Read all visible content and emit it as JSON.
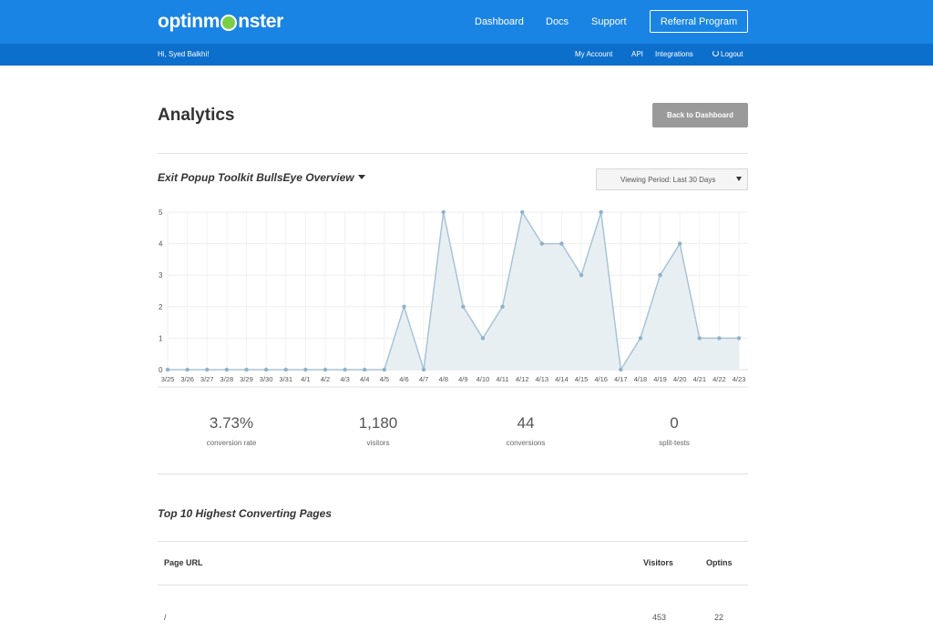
{
  "header": {
    "logo_pre": "optinm",
    "logo_post": "nster",
    "nav": [
      "Dashboard",
      "Docs",
      "Support"
    ],
    "referral_label": "Referral Program"
  },
  "subbar": {
    "greeting": "Hi, Syed Balkhi!",
    "my_account": "My Account",
    "api": "API",
    "integrations": "Integrations",
    "logout": "Logout"
  },
  "page": {
    "title": "Analytics",
    "back_label": "Back to Dashboard"
  },
  "overview": {
    "title": "Exit Popup Toolkit BullsEye Overview",
    "period_label": "Viewing Period: Last 30 Days"
  },
  "chart_data": {
    "type": "area",
    "categories": [
      "3/25",
      "3/26",
      "3/27",
      "3/28",
      "3/29",
      "3/30",
      "3/31",
      "4/1",
      "4/2",
      "4/3",
      "4/4",
      "4/5",
      "4/6",
      "4/7",
      "4/8",
      "4/9",
      "4/10",
      "4/11",
      "4/12",
      "4/13",
      "4/14",
      "4/15",
      "4/16",
      "4/17",
      "4/18",
      "4/19",
      "4/20",
      "4/21",
      "4/22",
      "4/23"
    ],
    "values": [
      0,
      0,
      0,
      0,
      0,
      0,
      0,
      0,
      0,
      0,
      0,
      0,
      2,
      0,
      5,
      2,
      1,
      2,
      5,
      4,
      4,
      3,
      5,
      0,
      1,
      3,
      4,
      1,
      1,
      1
    ],
    "ylim": [
      0,
      5
    ],
    "yticks": [
      "0",
      "1",
      "2",
      "3",
      "4",
      "5"
    ],
    "grid": true,
    "line_color": "#a8c4d6",
    "fill_color": "#e8eff3"
  },
  "stats": [
    {
      "value": "3.73%",
      "label": "conversion rate"
    },
    {
      "value": "1,180",
      "label": "visitors"
    },
    {
      "value": "44",
      "label": "conversions"
    },
    {
      "value": "0",
      "label": "split-tests"
    }
  ],
  "top_pages": {
    "title": "Top 10 Highest Converting Pages",
    "headers": {
      "url": "Page URL",
      "visitors": "Visitors",
      "optins": "Optins"
    },
    "rows": [
      {
        "url": "/",
        "visitors": "453",
        "optins": "22"
      }
    ]
  },
  "colors": {
    "header_bg": "#1a84e4",
    "subbar_bg": "#0d6fcc",
    "button_gray": "#9a9a9a"
  }
}
